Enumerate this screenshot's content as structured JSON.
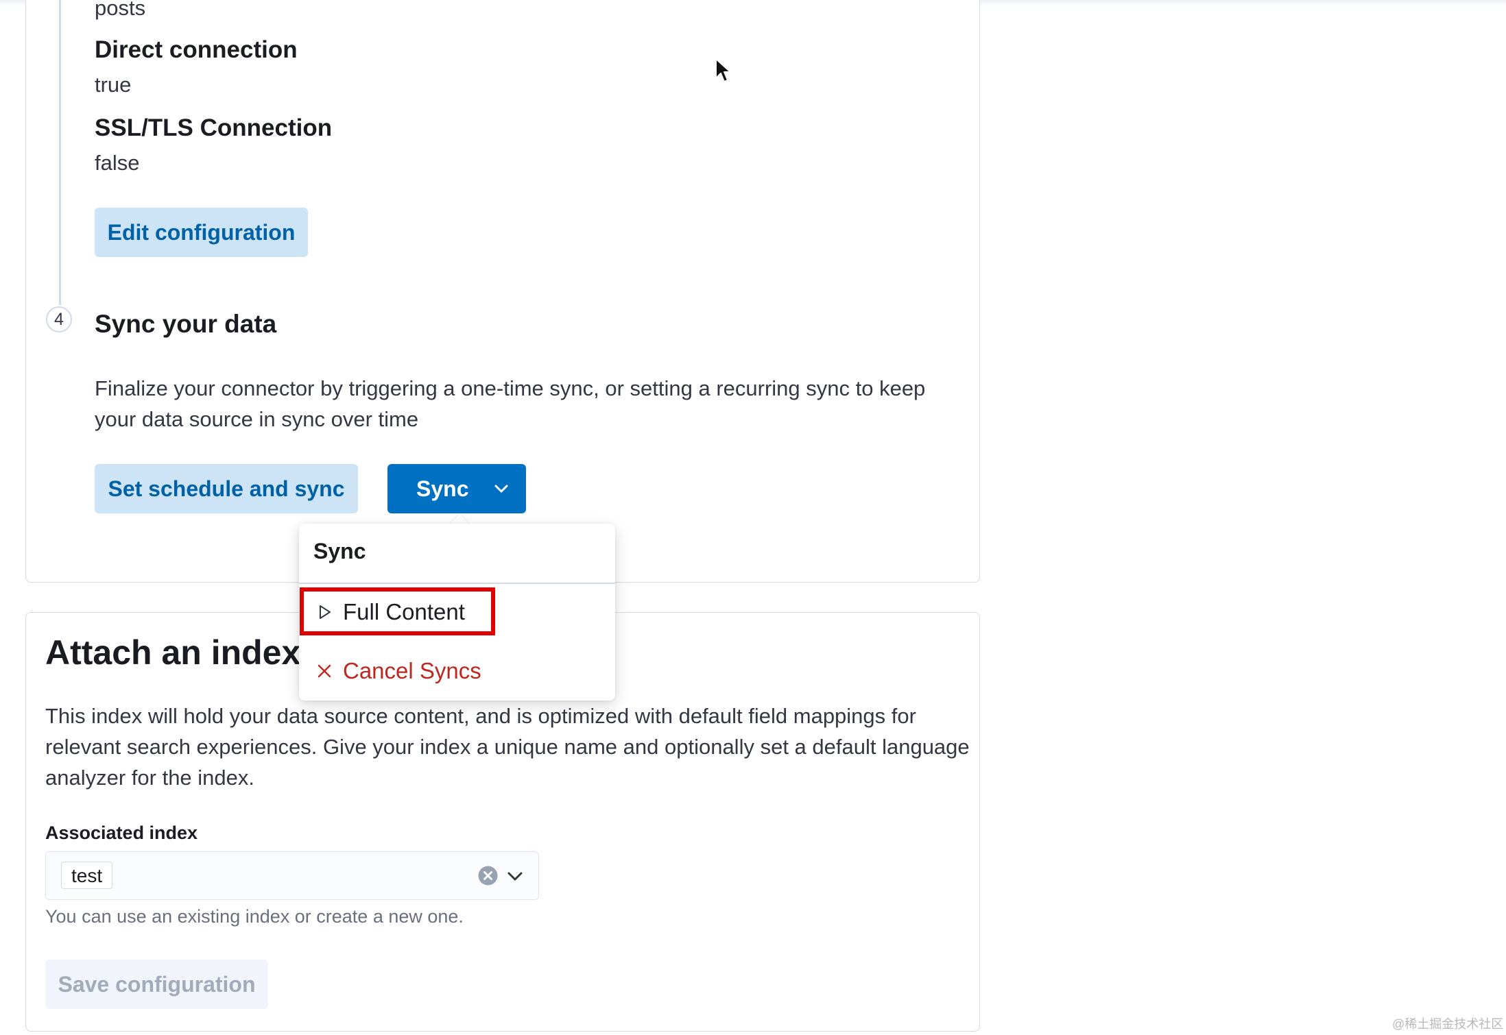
{
  "config_details": {
    "partial_value": "posts",
    "direct_connection_label": "Direct connection",
    "direct_connection_value": "true",
    "ssl_label": "SSL/TLS Connection",
    "ssl_value": "false",
    "edit_button": "Edit configuration"
  },
  "sync_step": {
    "number": "4",
    "title": "Sync your data",
    "description": "Finalize your connector by triggering a one-time sync, or setting a recurring sync to keep your data source in sync over time",
    "schedule_button": "Set schedule and sync",
    "sync_button": "Sync"
  },
  "sync_popover": {
    "title": "Sync",
    "items": [
      {
        "label": "Full Content",
        "icon": "play-icon"
      },
      {
        "label": "Cancel Syncs",
        "icon": "cross-icon",
        "color": "#bd271e"
      }
    ]
  },
  "attach_index": {
    "title": "Attach an index",
    "description": "This index will hold your data source content, and is optimized with default field mappings for relevant search experiences. Give your index a unique name and optionally set a default language analyzer for the index.",
    "field_label": "Associated index",
    "selected_value": "test",
    "help_text": "You can use an existing index or create a new one.",
    "save_button": "Save configuration"
  },
  "watermark": "@稀土掘金技术社区",
  "colors": {
    "primary": "#0071c2",
    "light_button": "#cce4f5",
    "danger": "#bd271e",
    "highlight": "#e00000"
  }
}
